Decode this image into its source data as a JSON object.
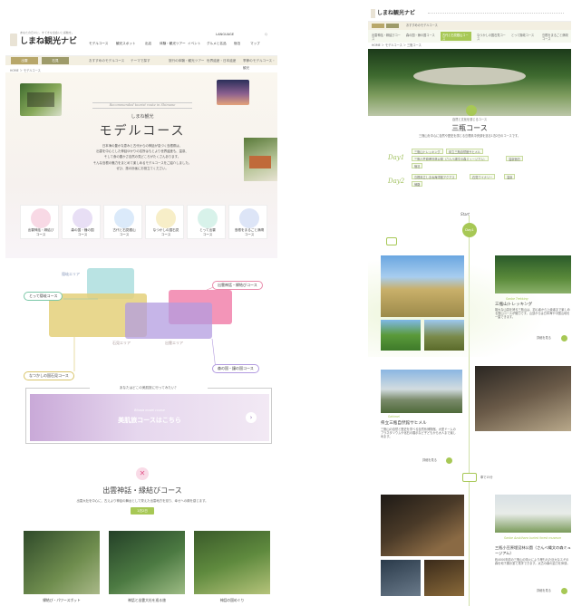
{
  "site": {
    "logo_tagline": "あなたの日々に、すてきな出会いと感動を。",
    "logo_name": "しまね観光ナビ"
  },
  "left": {
    "nav": [
      "モデルコース",
      "観光スポット",
      "出店",
      "体験・観光ツアー",
      "イベント",
      "グルメと名品",
      "宿泊",
      "マップ"
    ],
    "utility": [
      "LANGUAGE",
      "Q"
    ],
    "subbar_buttons": [
      "出雲",
      "石見"
    ],
    "subbar_tabs": [
      "おすすめのモデルコース",
      "テーマで探す",
      "旅行の体験・観光ツアー",
      "世界遺産・日本遺産",
      "季節のモデルコース・観光"
    ],
    "breadcrumb": "HOME ＞ モデルコース",
    "hero": {
      "eyebrow": "Recommended tourist route in Shimane",
      "kicker": "しまね観光",
      "title": "モデルコース",
      "body": [
        "日本海の豊かな恵みと古代からの神話が息づく島根県は、",
        "出雲を中心とした神話ゆかりの名所はもとより世界遺産も、温泉、",
        "そして食の豊かさ自然の見どころがたくさんあります。",
        "そんな島根の魅力をまとめて楽しめるモデルコースをご紹介しました。",
        "ぜひ、旅の計画にお役立てください。"
      ]
    },
    "courses": [
      {
        "label": "出雲神話・縁結び",
        "sub": "コース",
        "color": "#e2598c"
      },
      {
        "label": "森の国・鐘の国",
        "sub": "コース",
        "color": "#8f6fc2"
      },
      {
        "label": "古代と石見銀山",
        "sub": "コース",
        "color": "#6aa6e0"
      },
      {
        "label": "なつかしの国石見",
        "sub": "コース",
        "color": "#d0b23a"
      },
      {
        "label": "とって出雲",
        "sub": "コース",
        "color": "#5fc0a2"
      },
      {
        "label": "島根をまるごと満喫",
        "sub": "コース",
        "color": "#5f86d6"
      }
    ],
    "map": {
      "areas": [
        "隠岐エリア",
        "出雲エリア",
        "石見エリア"
      ],
      "labels": [
        "とって隠岐コース",
        "出雲神話・縁結びコース",
        "森の国・鐘の国コース",
        "なつかしの国石見コース"
      ]
    },
    "banner": {
      "question": "あなたはどこの美肌旅に行ってみたい？",
      "sub": "Bihada model course",
      "title": "美肌旅コースはこちら"
    },
    "section": {
      "title": "出雲神話・縁結びコース",
      "body": "出雲大社を中心に、古えより神話の舞台として栄えた出雲地方を巡り、幸せへの縁を感じます。",
      "button": "1泊2日",
      "cards": [
        "縁結び・パワースポット",
        "神話と出雲大社を巡る旅",
        "神話の国めぐり"
      ]
    }
  },
  "right": {
    "nav_tabs": [
      "おすすめのモデルコース",
      "テーマで探す",
      "旅行・観光ツアー",
      "世界遺産・日本遺産",
      "季節のモデルコース・観光"
    ],
    "course_tabs": [
      "出雲神話・縁結びコース",
      "森の国・鐘の国コース",
      "古代と石見銀山コース",
      "なつかしの国石見コース",
      "とって隠岐コース",
      "島根をまるごと満喫コース"
    ],
    "breadcrumb": "HOME ＞ モデルコース ＞ 三瓶コース",
    "title_kicker": "自然と文化を感じるコース",
    "title": "三瓶コース",
    "subtitle": "三瓶山を中心に自然や歴史を感じる島根県中央部を巡る1泊2日のコースです。",
    "day1_label": "Day1",
    "day1_tags": [
      "三瓶山トレッキング",
      "県立三瓶自然館サヒメル",
      "三瓶小豆原埋没林公園（さんべ縄文の森ミュージアム）",
      "温泉宿泊",
      "宿泊"
    ],
    "day2_label": "Day2",
    "day2_tags": [
      "島根県立しまね海洋館アクアス",
      "石見ワイナリー",
      "温泉",
      "帰路"
    ],
    "start": "Start",
    "day1_badge": "Day1",
    "spot1": {
      "eyebrow": "Sanbe Trekking",
      "title": "三瓶山トレッキング",
      "desc": "雄大な山容を誇る三瓶山は、初心者から上級者まで楽しめる登山コースが魅力です。山頂からは日本海や中国山地を一望できます。",
      "link": "詳細を見る"
    },
    "spot2": {
      "eyebrow": "Sahimel",
      "title": "県立三瓶自然館サヒメル",
      "desc": "三瓶山の自然と歴史を学べる自然系博物館。大型ドームのプラネタリウムや化石の展示など子どもから大人まで楽しめます。",
      "link": "詳細を見る"
    },
    "move": "車で15分",
    "spot3": {
      "eyebrow": "Sanbe Azukihara buried forest museum",
      "title": "三瓶小豆原埋没林公園（さんべ縄文の森ミュージアム）",
      "desc": "約4000年前の三瓶山の噴火により埋もれた巨大なスギの森を地下展示室で見学できます。太古の森の迫力を体感。",
      "link": "詳細を見る"
    }
  }
}
